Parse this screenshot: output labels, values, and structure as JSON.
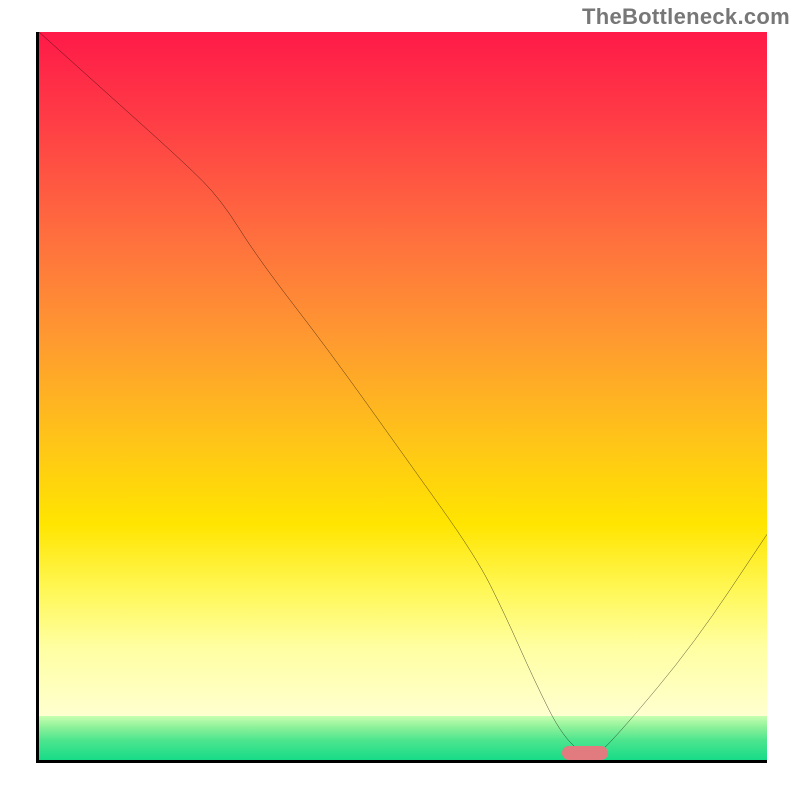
{
  "attribution": "TheBottleneck.com",
  "chart_data": {
    "type": "line",
    "title": "",
    "xlabel": "",
    "ylabel": "",
    "xlim": [
      0,
      100
    ],
    "ylim": [
      0,
      100
    ],
    "x": [
      0,
      10,
      20,
      25,
      30,
      40,
      50,
      60,
      64,
      68,
      72,
      76,
      80,
      90,
      100
    ],
    "values": [
      100,
      91,
      82,
      77,
      69,
      56,
      42,
      28,
      20,
      11,
      3,
      0,
      4,
      16,
      31
    ],
    "marker": {
      "x": 75,
      "y": 1
    },
    "background": "rainbow-gradient"
  }
}
